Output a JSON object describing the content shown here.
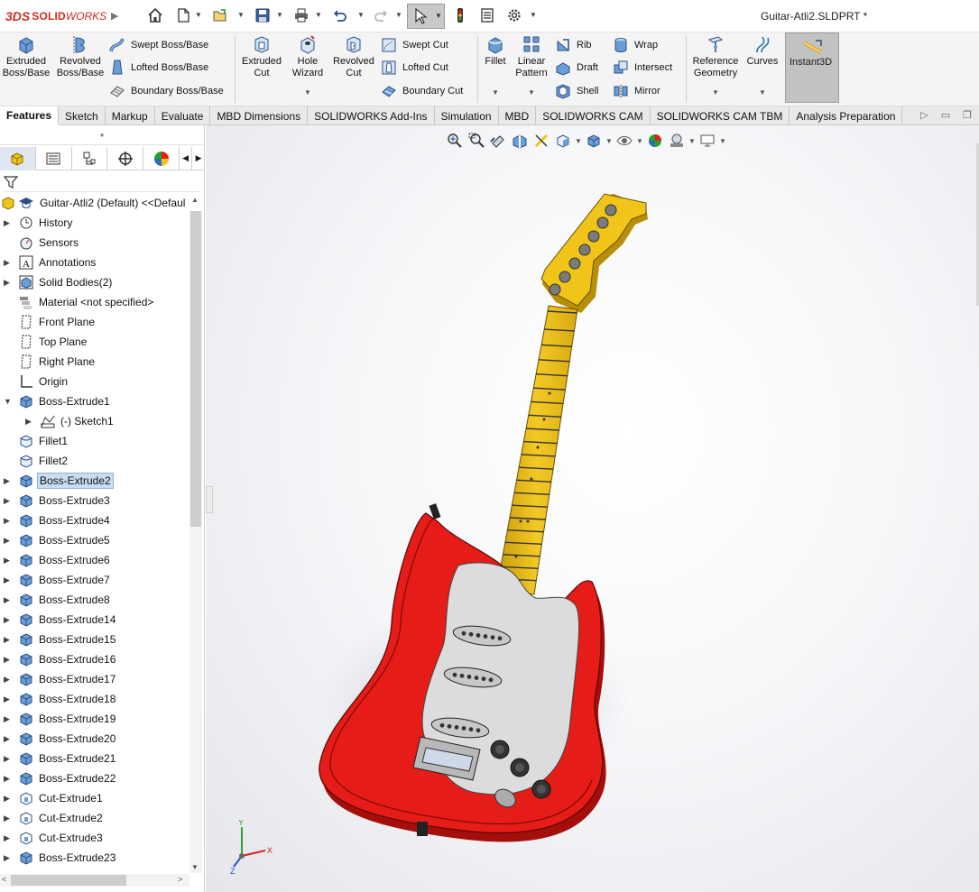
{
  "app": {
    "brand_prefix": "3DS",
    "brand_name": "SOLID",
    "brand_name2": "WORKS",
    "document_title": "Guitar-Atli2.SLDPRT *"
  },
  "ribbon": {
    "extruded_boss": "Extruded\nBoss/Base",
    "revolved_boss": "Revolved\nBoss/Base",
    "swept_boss": "Swept Boss/Base",
    "lofted_boss": "Lofted Boss/Base",
    "boundary_boss": "Boundary Boss/Base",
    "extruded_cut": "Extruded\nCut",
    "hole_wizard": "Hole\nWizard",
    "revolved_cut": "Revolved\nCut",
    "swept_cut": "Swept Cut",
    "lofted_cut": "Lofted Cut",
    "boundary_cut": "Boundary Cut",
    "fillet": "Fillet",
    "linear_pattern": "Linear\nPattern",
    "rib": "Rib",
    "draft": "Draft",
    "shell": "Shell",
    "wrap": "Wrap",
    "intersect": "Intersect",
    "mirror": "Mirror",
    "reference_geometry": "Reference\nGeometry",
    "curves": "Curves",
    "instant3d": "Instant3D"
  },
  "tabs": [
    "Features",
    "Sketch",
    "Markup",
    "Evaluate",
    "MBD Dimensions",
    "SOLIDWORKS Add-Ins",
    "Simulation",
    "MBD",
    "SOLIDWORKS CAM",
    "SOLIDWORKS CAM TBM",
    "Analysis Preparation"
  ],
  "tree": {
    "root": "Guitar-Atli2 (Default) <<Defaul",
    "items": [
      {
        "label": "History",
        "expandable": true
      },
      {
        "label": "Sensors",
        "expandable": false
      },
      {
        "label": "Annotations",
        "expandable": true
      },
      {
        "label": "Solid Bodies(2)",
        "expandable": true
      },
      {
        "label": "Material <not specified>",
        "expandable": false
      },
      {
        "label": "Front Plane",
        "expandable": false
      },
      {
        "label": "Top Plane",
        "expandable": false
      },
      {
        "label": "Right Plane",
        "expandable": false
      },
      {
        "label": "Origin",
        "expandable": false
      },
      {
        "label": "Boss-Extrude1",
        "expandable": true,
        "expanded": true
      },
      {
        "label": "(-) Sketch1",
        "expandable": true,
        "child": true
      },
      {
        "label": "Fillet1",
        "expandable": false
      },
      {
        "label": "Fillet2",
        "expandable": false
      },
      {
        "label": "Boss-Extrude2",
        "expandable": true,
        "selected": true
      },
      {
        "label": "Boss-Extrude3",
        "expandable": true
      },
      {
        "label": "Boss-Extrude4",
        "expandable": true
      },
      {
        "label": "Boss-Extrude5",
        "expandable": true
      },
      {
        "label": "Boss-Extrude6",
        "expandable": true
      },
      {
        "label": "Boss-Extrude7",
        "expandable": true
      },
      {
        "label": "Boss-Extrude8",
        "expandable": true
      },
      {
        "label": "Boss-Extrude14",
        "expandable": true
      },
      {
        "label": "Boss-Extrude15",
        "expandable": true
      },
      {
        "label": "Boss-Extrude16",
        "expandable": true
      },
      {
        "label": "Boss-Extrude17",
        "expandable": true
      },
      {
        "label": "Boss-Extrude18",
        "expandable": true
      },
      {
        "label": "Boss-Extrude19",
        "expandable": true
      },
      {
        "label": "Boss-Extrude20",
        "expandable": true
      },
      {
        "label": "Boss-Extrude21",
        "expandable": true
      },
      {
        "label": "Boss-Extrude22",
        "expandable": true
      },
      {
        "label": "Cut-Extrude1",
        "expandable": true
      },
      {
        "label": "Cut-Extrude2",
        "expandable": true
      },
      {
        "label": "Cut-Extrude3",
        "expandable": true
      },
      {
        "label": "Boss-Extrude23",
        "expandable": true
      }
    ]
  },
  "triad": {
    "x": "X",
    "y": "Y",
    "z": "Z"
  },
  "colors": {
    "body": "#e51c17",
    "body_dark": "#a40f0c",
    "pickguard": "#dcdcdc",
    "neck": "#f0c419",
    "neck_dark": "#b88f0a",
    "accent": "#c8dcf2"
  }
}
